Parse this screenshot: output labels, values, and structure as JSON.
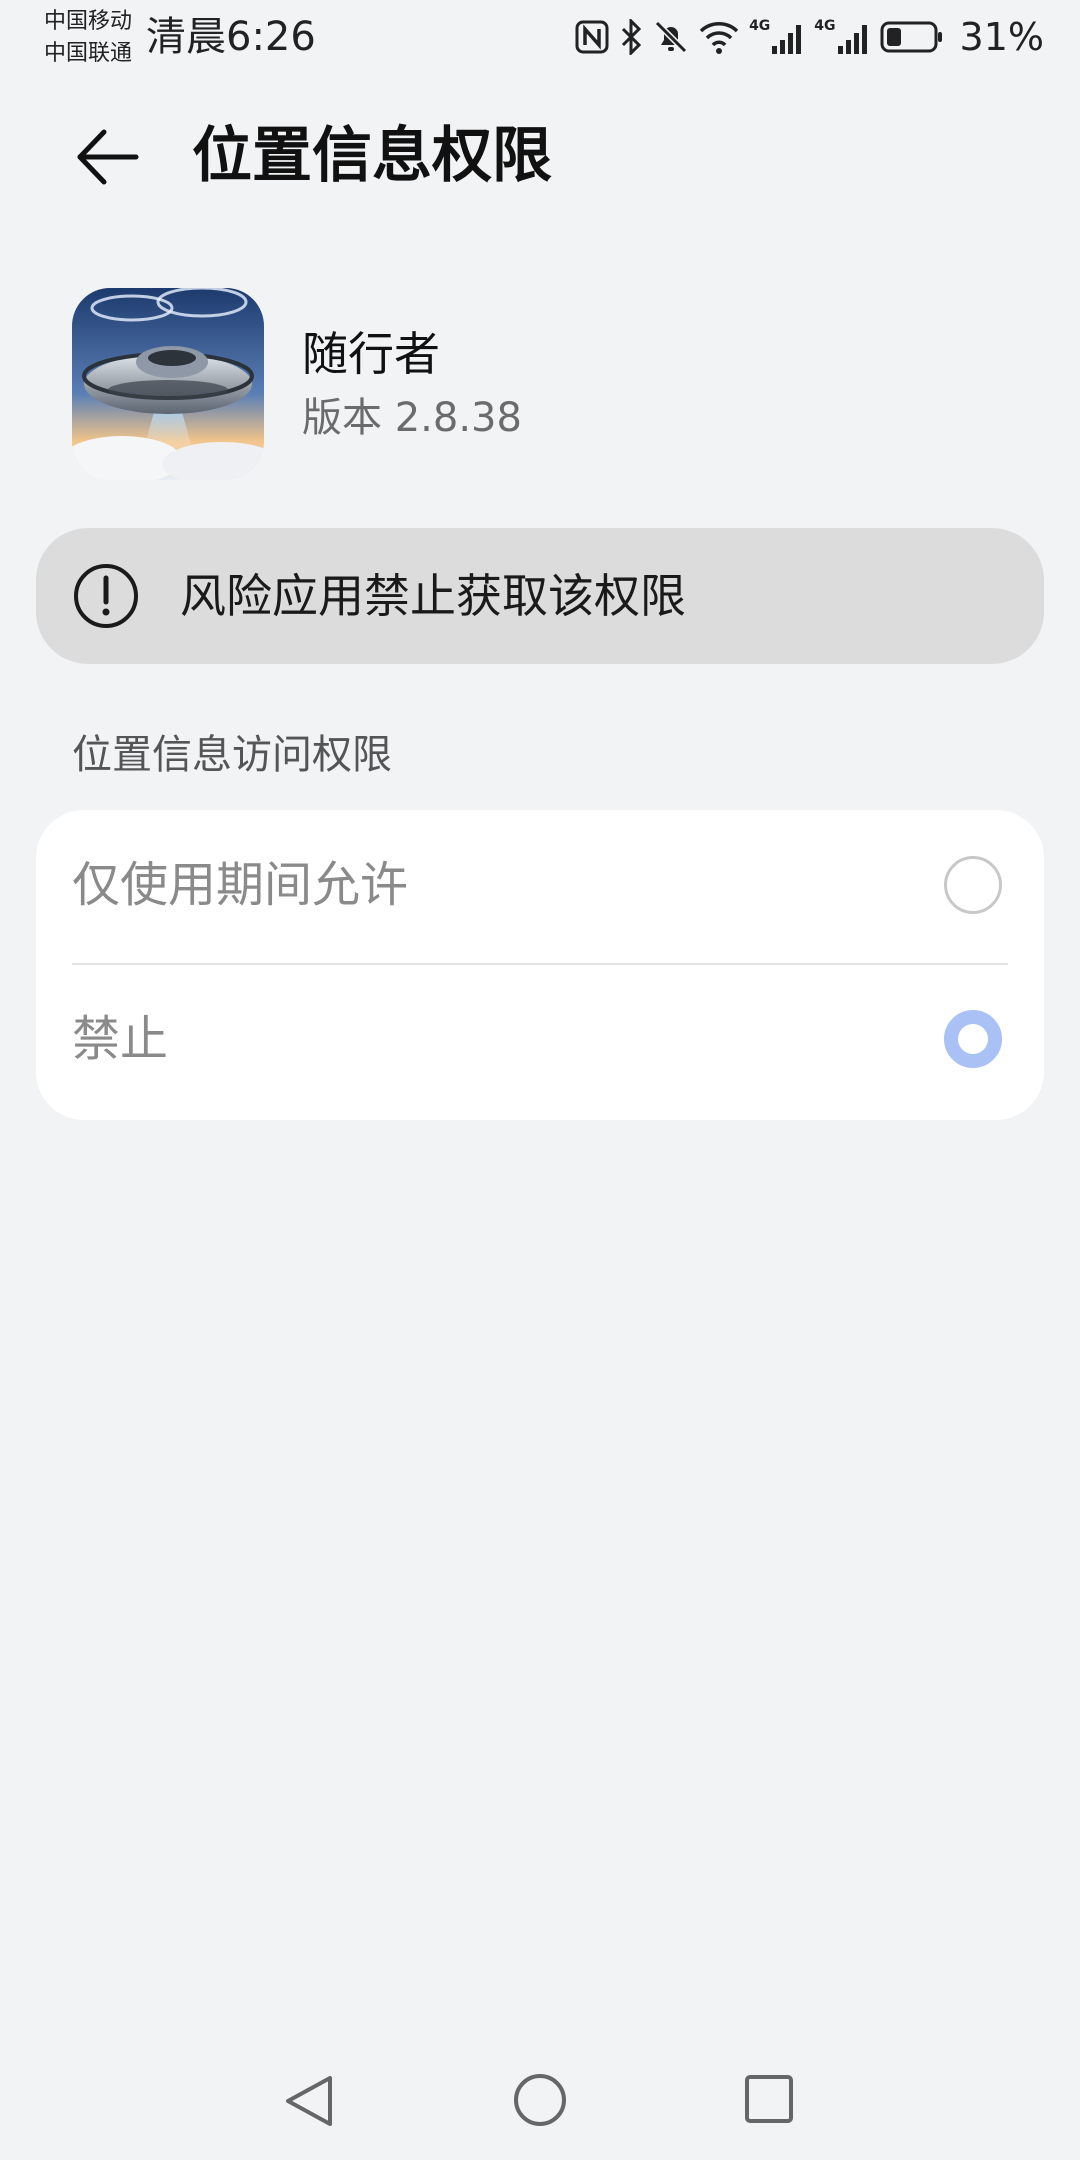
{
  "status_bar": {
    "carrier_1": "中国移动",
    "carrier_2": "中国联通",
    "time": "清晨6:26",
    "network_1": "4G",
    "network_2": "4G",
    "battery_percent": "31%",
    "battery_level": 0.31,
    "icons": [
      "nfc-icon",
      "bluetooth-icon",
      "bell-muted-icon",
      "wifi-icon",
      "signal-icon",
      "signal-icon",
      "battery-icon"
    ]
  },
  "header": {
    "title": "位置信息权限",
    "back_icon": "arrow-left-icon"
  },
  "app": {
    "name": "随行者",
    "version": "版本 2.8.38"
  },
  "warning": {
    "icon": "exclamation-circle-icon",
    "text": "风险应用禁止获取该权限"
  },
  "section": {
    "title": "位置信息访问权限"
  },
  "options": [
    {
      "label": "仅使用期间允许",
      "selected": false
    },
    {
      "label": "禁止",
      "selected": true
    }
  ],
  "colors": {
    "background": "#f1f3f5",
    "card": "#ffffff",
    "warning_bg": "#dcdcdd",
    "radio_selected": "#a9c1f5",
    "radio_unselected": "#c8c8c8",
    "option_text": "#8a8a8a"
  },
  "nav_bar": {
    "icons": [
      "nav-back-icon",
      "nav-home-icon",
      "nav-recents-icon"
    ]
  }
}
